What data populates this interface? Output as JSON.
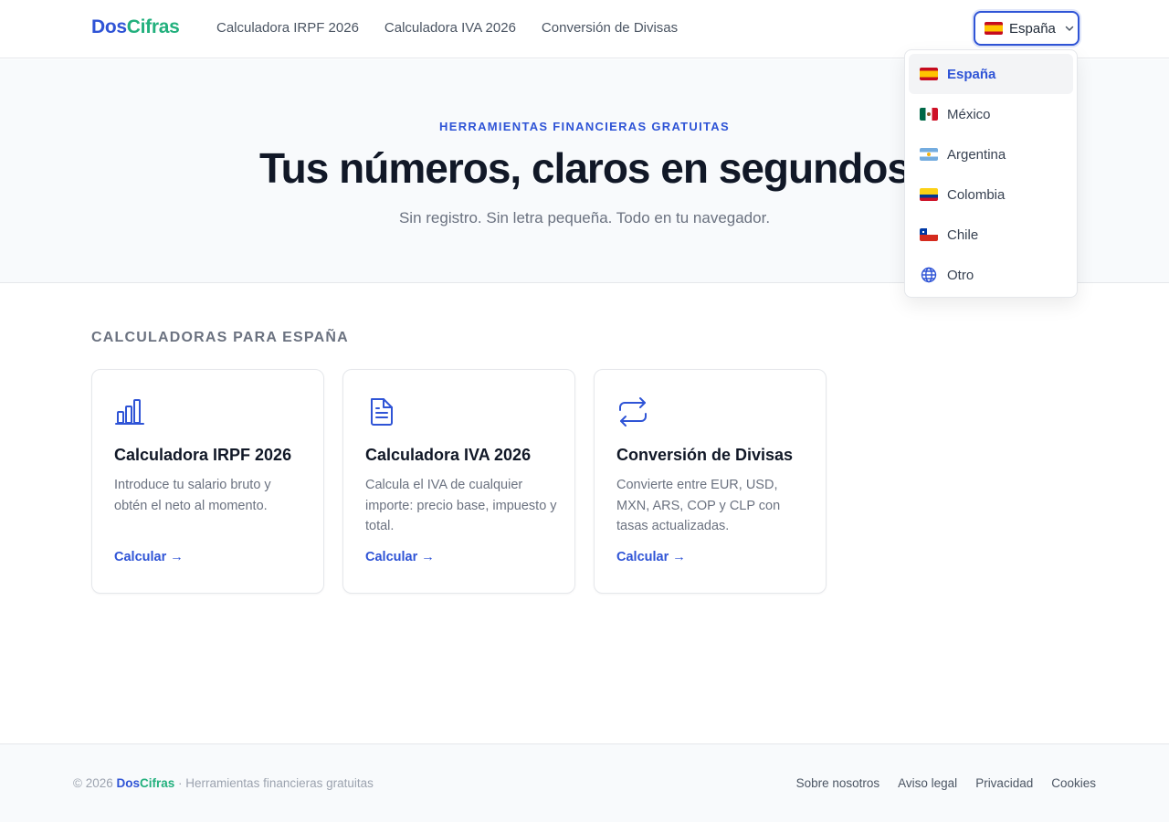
{
  "header": {
    "logo_part1": "Dos",
    "logo_part2": "Cifras",
    "nav": [
      {
        "label": "Calculadora IRPF 2026"
      },
      {
        "label": "Calculadora IVA 2026"
      },
      {
        "label": "Conversión de Divisas"
      }
    ],
    "country_selector": {
      "label": "España",
      "flag": "flag-es",
      "icon": "chevron-down-icon"
    }
  },
  "dropdown": {
    "items": [
      {
        "label": "España",
        "flag": "flag-es",
        "selected": true
      },
      {
        "label": "México",
        "flag": "flag-mx"
      },
      {
        "label": "Argentina",
        "flag": "flag-ar"
      },
      {
        "label": "Colombia",
        "flag": "flag-co"
      },
      {
        "label": "Chile",
        "flag": "flag-cl"
      },
      {
        "label": "Otro",
        "icon": "globe-icon"
      }
    ]
  },
  "hero": {
    "eyebrow": "HERRAMIENTAS FINANCIERAS GRATUITAS",
    "title": "Tus números, claros en segundos",
    "subtitle": "Sin registro. Sin letra pequeña. Todo en tu navegador."
  },
  "section": {
    "title": "CALCULADORAS PARA ESPAÑA",
    "cards": [
      {
        "icon": "bar-chart-icon",
        "title": "Calculadora IRPF 2026",
        "description": "Introduce tu salario bruto y obtén el neto al momento.",
        "link": "Calcular →"
      },
      {
        "icon": "document-icon",
        "title": "Calculadora IVA 2026",
        "description": "Calcula el IVA de cualquier importe: precio base, impuesto y total.",
        "link": "Calcular →"
      },
      {
        "icon": "exchange-icon",
        "title": "Conversión de Divisas",
        "description": "Convierte entre EUR, USD, MXN, ARS, COP y CLP con tasas actualizadas.",
        "link": "Calcular →"
      }
    ]
  },
  "footer": {
    "copyright_prefix": "© 2026",
    "brand_part1": "Dos",
    "brand_part2": "Cifras",
    "tagline": "· Herramientas financieras gratuitas",
    "links": [
      {
        "label": "Sobre nosotros"
      },
      {
        "label": "Aviso legal"
      },
      {
        "label": "Privacidad"
      },
      {
        "label": "Cookies"
      }
    ]
  },
  "colors": {
    "accent": "#2f54d6",
    "brand_green": "#22b07d",
    "text": "#111827",
    "muted": "#6b7280"
  }
}
